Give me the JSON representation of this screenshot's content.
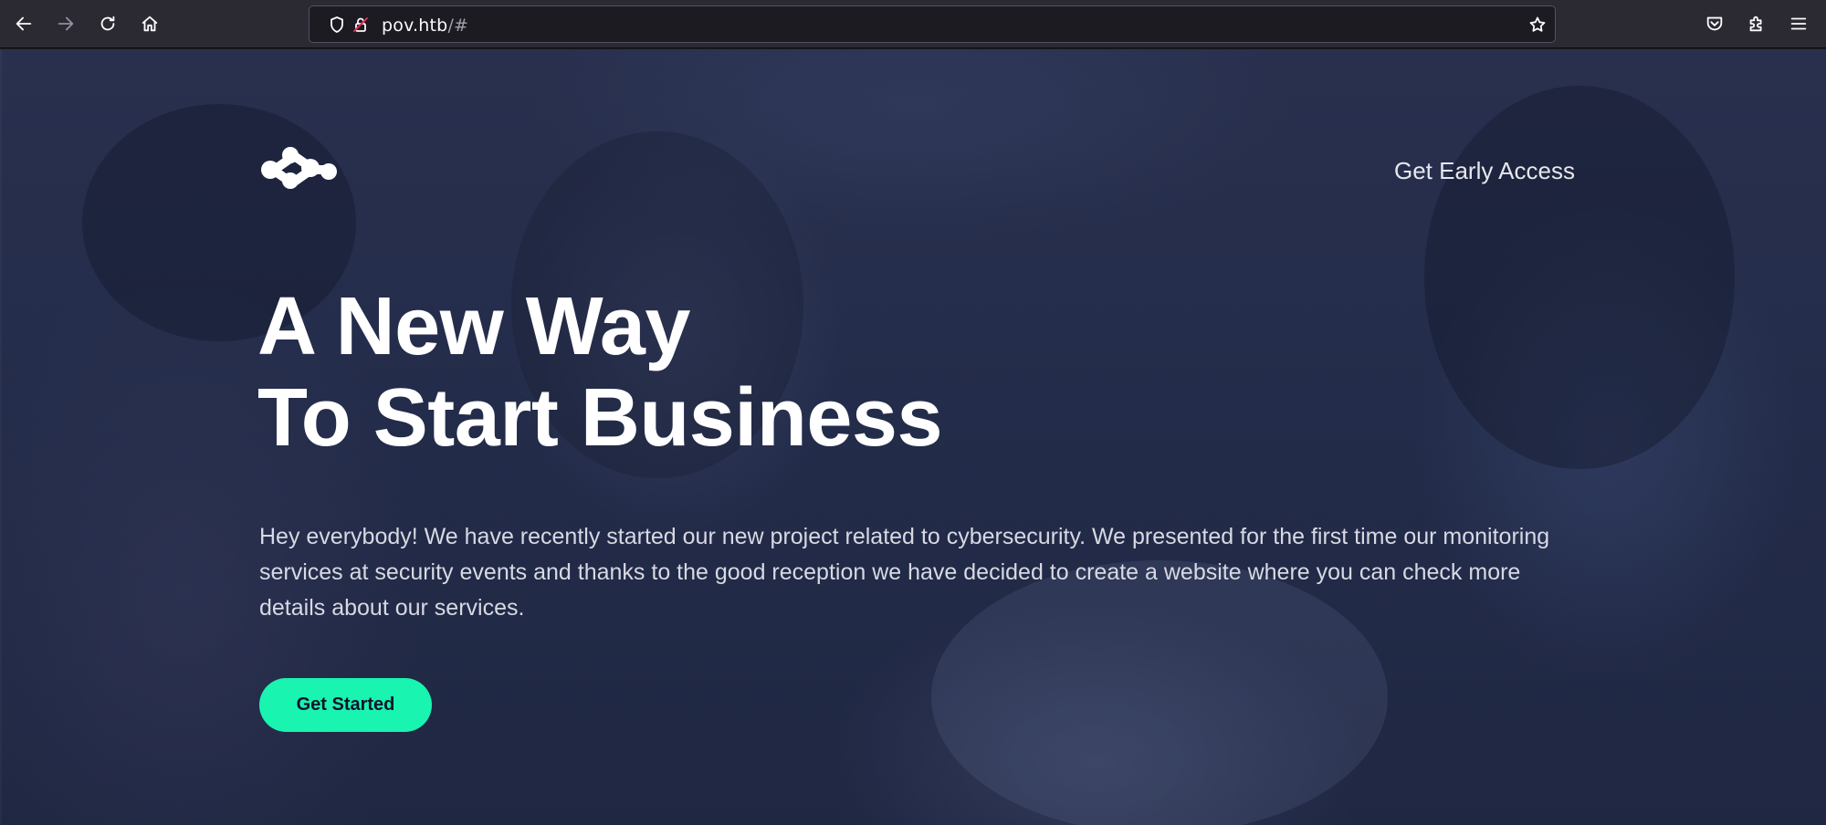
{
  "browser": {
    "url_host": "pov.htb",
    "url_path": "/#",
    "icons": {
      "back": "arrow-left-icon",
      "forward": "arrow-right-icon",
      "reload": "reload-icon",
      "home": "home-icon",
      "shield": "tracking-shield-icon",
      "lock": "insecure-lock-icon",
      "bookmark": "star-icon",
      "pocket": "pocket-icon",
      "extensions": "puzzle-icon",
      "menu": "hamburger-menu-icon"
    }
  },
  "site": {
    "nav_cta": "Get Early Access",
    "hero": {
      "title_line1": "A New Way",
      "title_line2": "To Start Business",
      "description": "Hey everybody! We have recently started our new project related to cybersecurity. We presented for the first time our monitoring services at security events and thanks to the good reception we have decided to create a website where you can check more details about our services.",
      "button": "Get Started"
    },
    "colors": {
      "accent": "#19f4b0",
      "overlay": "#263050",
      "text": "#ffffff"
    }
  }
}
